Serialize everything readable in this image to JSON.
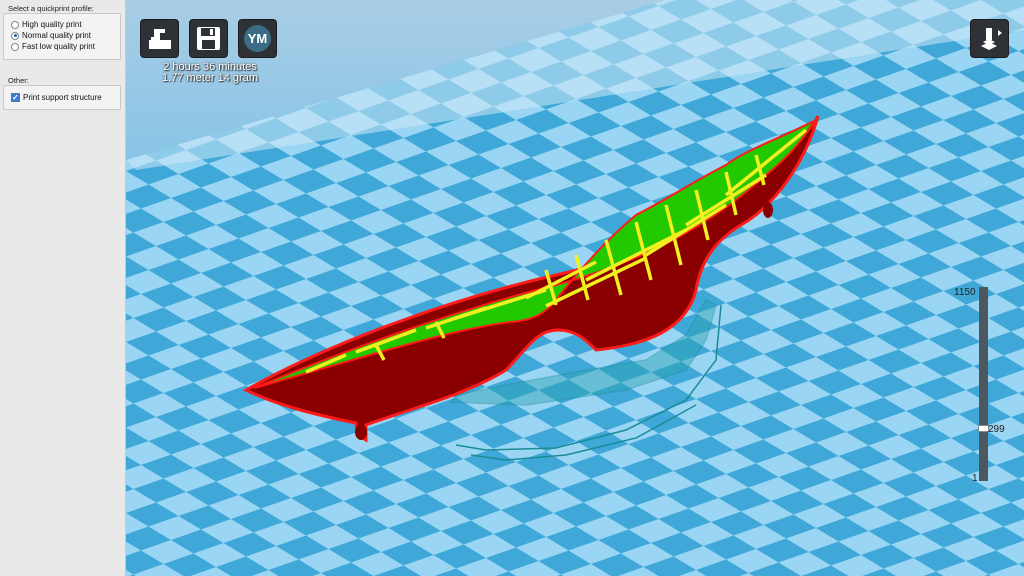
{
  "sidebar": {
    "quickprint_label": "Select a quickprint profile:",
    "profiles": [
      {
        "label": "High quality print",
        "selected": false
      },
      {
        "label": "Normal quality print",
        "selected": true
      },
      {
        "label": "Fast low quality print",
        "selected": false
      }
    ],
    "other_label": "Other:",
    "support_label": "Print support structure",
    "support_checked": true
  },
  "toolbar": {
    "load_icon": "load-model-icon",
    "save_icon": "save-disk-icon",
    "ym_label": "YM",
    "view_icon": "view-mode-icon"
  },
  "print_info": {
    "time": "2 hours 36 minutes",
    "material": "1.77 meter 14 gram"
  },
  "layer_slider": {
    "max": "1150",
    "current": "299",
    "min": "1"
  },
  "colors": {
    "shell": "#8a0000",
    "outline": "#ff1a1a",
    "inner_wall": "#22c800",
    "infill": "#f0f020",
    "bed_dark": "#3fa8d8",
    "bed_light": "#9ad6f4"
  }
}
